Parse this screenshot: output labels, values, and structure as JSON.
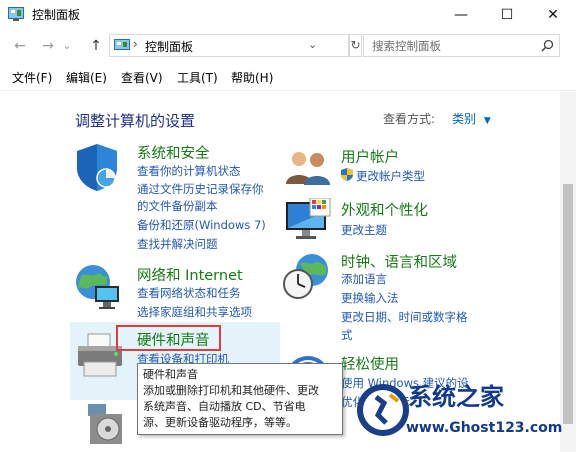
{
  "window": {
    "title": "控制面板",
    "minimize": "—",
    "maximize": "☐",
    "close": "✕"
  },
  "nav": {
    "back": "←",
    "forward": "→",
    "dropdown": "⌄",
    "up": "↑",
    "address": "控制面板",
    "address_separator": "›",
    "refresh": "↻",
    "search_placeholder": "搜索控制面板"
  },
  "menu": [
    "文件(F)",
    "编辑(E)",
    "查看(V)",
    "工具(T)",
    "帮助(H)"
  ],
  "main": {
    "heading": "调整计算机的设置",
    "view_by_label": "查看方式:",
    "view_by_value": "类别"
  },
  "categories_left": [
    {
      "title": "系统和安全",
      "icon": "shield-icon",
      "links": [
        "查看你的计算机状态",
        "通过文件历史记录保存你",
        "的文件备份副本",
        "备份和还原(Windows 7)",
        "查找并解决问题"
      ]
    },
    {
      "title": "网络和 Internet",
      "icon": "globe-network-icon",
      "links": [
        "查看网络状态和任务",
        "选择家庭组和共享选项"
      ]
    },
    {
      "title": "硬件和声音",
      "icon": "printer-icon",
      "links": [
        "查看设备和打印机"
      ]
    },
    {
      "title": "",
      "icon": "programs-icon",
      "links": []
    }
  ],
  "categories_right": [
    {
      "title": "用户帐户",
      "icon": "users-icon",
      "links": [
        "更改帐户类型"
      ]
    },
    {
      "title": "外观和个性化",
      "icon": "monitor-icon",
      "links": [
        "更改主题"
      ]
    },
    {
      "title": "时钟、语言和区域",
      "icon": "clock-globe-icon",
      "links": [
        "添加语言",
        "更换输入法",
        "更改日期、时间或数字格",
        "式"
      ]
    },
    {
      "title": "轻松使用",
      "icon": "ease-of-access-icon",
      "links": [
        "使用 Windows 建议的设",
        "优化视觉显示"
      ]
    }
  ],
  "tooltip": {
    "title": "硬件和声音",
    "body": [
      "添加或删除打印机和其他硬件、更改",
      "系统声音、自动播放 CD、节省电",
      "源、更新设备驱动程序，等等。"
    ]
  },
  "watermark": {
    "title": "系统之家",
    "url": "www.Ghost123.com"
  },
  "colors": {
    "heading": "#1e3287",
    "category_title": "#157b15",
    "link": "#2258b6",
    "highlight": "#e13b3b",
    "hover": "#e5f3fb"
  }
}
